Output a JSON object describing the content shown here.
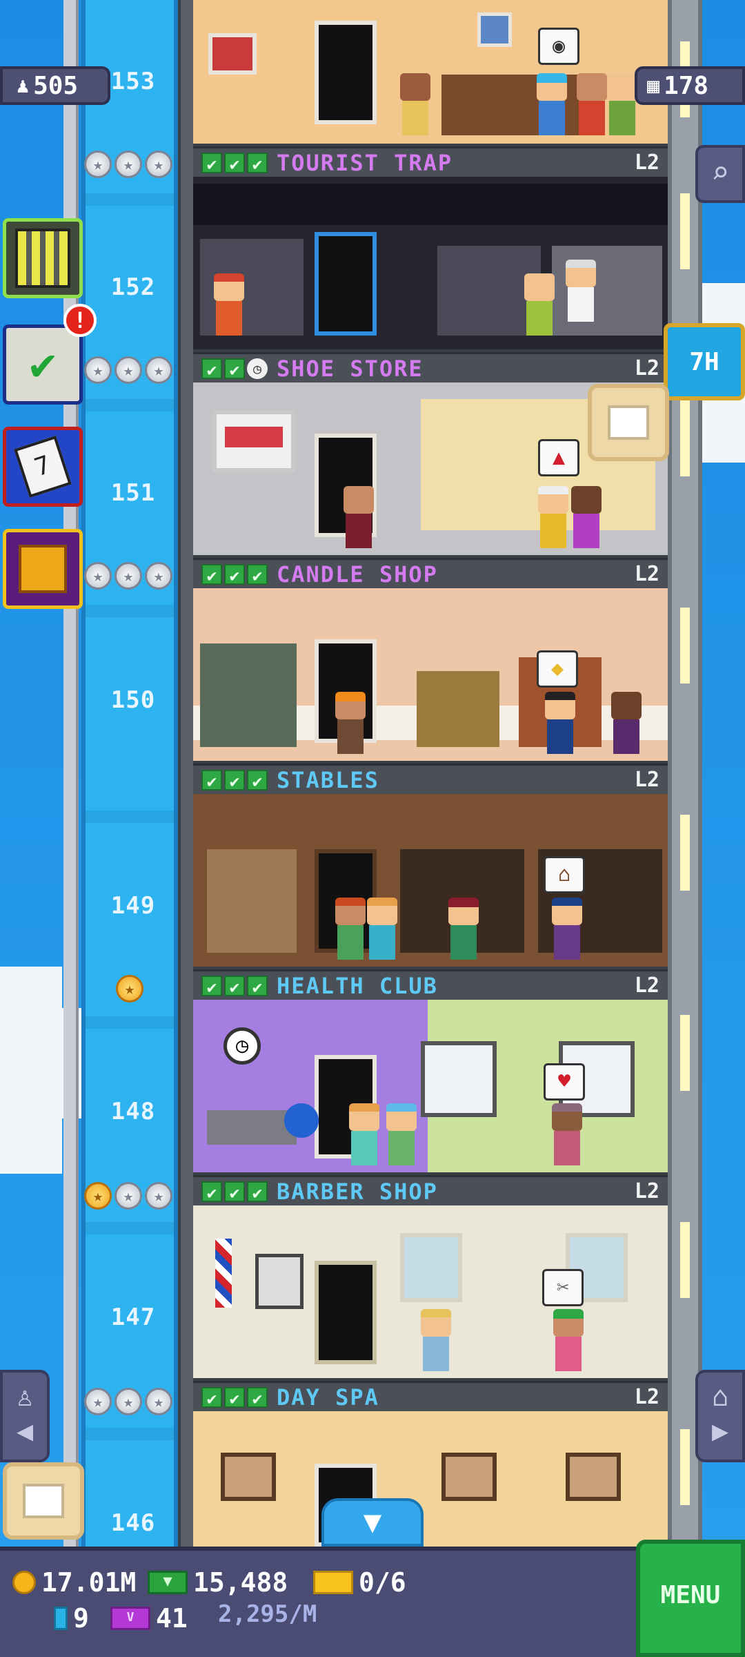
{
  "hud": {
    "population": "505",
    "floor_count": "178",
    "timer_label": "7H",
    "alert_count": "!"
  },
  "floor_numbers": [
    "153",
    "152",
    "151",
    "150",
    "149",
    "148",
    "147",
    "146"
  ],
  "floors": [
    {
      "name": "TOURIST TRAP",
      "level": "L2",
      "name_color": "#d57bf0"
    },
    {
      "name": "SHOE STORE",
      "level": "L2",
      "name_color": "#d57bf0"
    },
    {
      "name": "CANDLE SHOP",
      "level": "L2",
      "name_color": "#d57bf0"
    },
    {
      "name": "STABLES",
      "level": "L2",
      "name_color": "#5fc9f5"
    },
    {
      "name": "HEALTH CLUB",
      "level": "L2",
      "name_color": "#5fc9f5"
    },
    {
      "name": "BARBER SHOP",
      "level": "L2",
      "name_color": "#5fc9f5"
    },
    {
      "name": "DAY SPA",
      "level": "L2",
      "name_color": "#5fc9f5"
    }
  ],
  "bottom_bar": {
    "coins": "17.01M",
    "bux_cash": "15,488",
    "tickets": "0/6",
    "tower_bux": "9",
    "vip": "41",
    "rate": "2,295/M",
    "menu_label": "MENU"
  },
  "icons": {
    "population": "person-icon",
    "floors": "building-grid-icon",
    "search": "magnifier-icon",
    "home": "home-icon",
    "elevator": "elevator-icon",
    "down": "chevron-down-icon"
  },
  "colors": {
    "sky": "#1e8fe0",
    "shaft": "#2db4f0",
    "bar": "#4a4c73",
    "menu": "#26b14a",
    "check": "#2ea843"
  }
}
